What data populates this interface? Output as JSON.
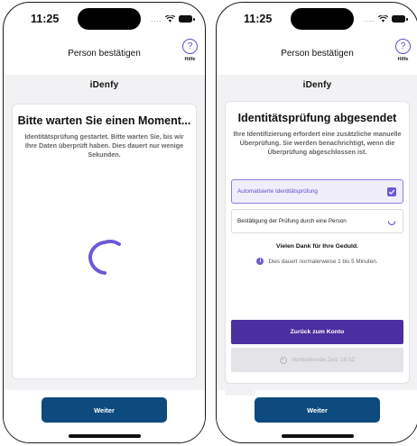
{
  "status_bar": {
    "time": "11:25",
    "signal": "....",
    "wifi_icon": "wifi-icon",
    "battery_icon": "battery-icon"
  },
  "colors": {
    "accent": "#6b5bd6",
    "primary_dark": "#4b2fa0",
    "weiter_btn": "#0d4a7e"
  },
  "screen1": {
    "nav_title": "Person bestätigen",
    "help_symbol": "?",
    "help_label": "Hilfe",
    "logo": "iDenfy",
    "card_title": "Bitte warten Sie einen Moment...",
    "card_description": "Identitätsprüfung gestartet. Bitte warten Sie, bis wir Ihre Daten überprüft haben. Dies dauert nur wenige Sekunden.",
    "button_label": "Weiter"
  },
  "screen2": {
    "nav_title": "Person bestätigen",
    "help_symbol": "?",
    "help_label": "Hilfe",
    "logo": "iDenfy",
    "card_title": "Identitätsprüfung abgesendet",
    "card_description": "Ihre Identifizierung erfordert eine zusätzliche manuelle Überprüfung. Sie werden benachrichtigt, wenn die Überprüfung abgeschlossen ist.",
    "options": [
      {
        "label": "Automatisierte Identitätsprüfung",
        "state": "checked"
      },
      {
        "label": "Bestätigung der Prüfung durch eine Person",
        "state": "loading"
      }
    ],
    "thanks_text": "Vielen Dank für Ihre Geduld.",
    "info_symbol": "i",
    "info_text": "Dies dauert normalerweise 1 bis 5 Minuten.",
    "back_button_label": "Zurück zum Konto",
    "remaining_time_label": "Verbleibende Zeit: 18:52",
    "button_label": "Weiter"
  }
}
